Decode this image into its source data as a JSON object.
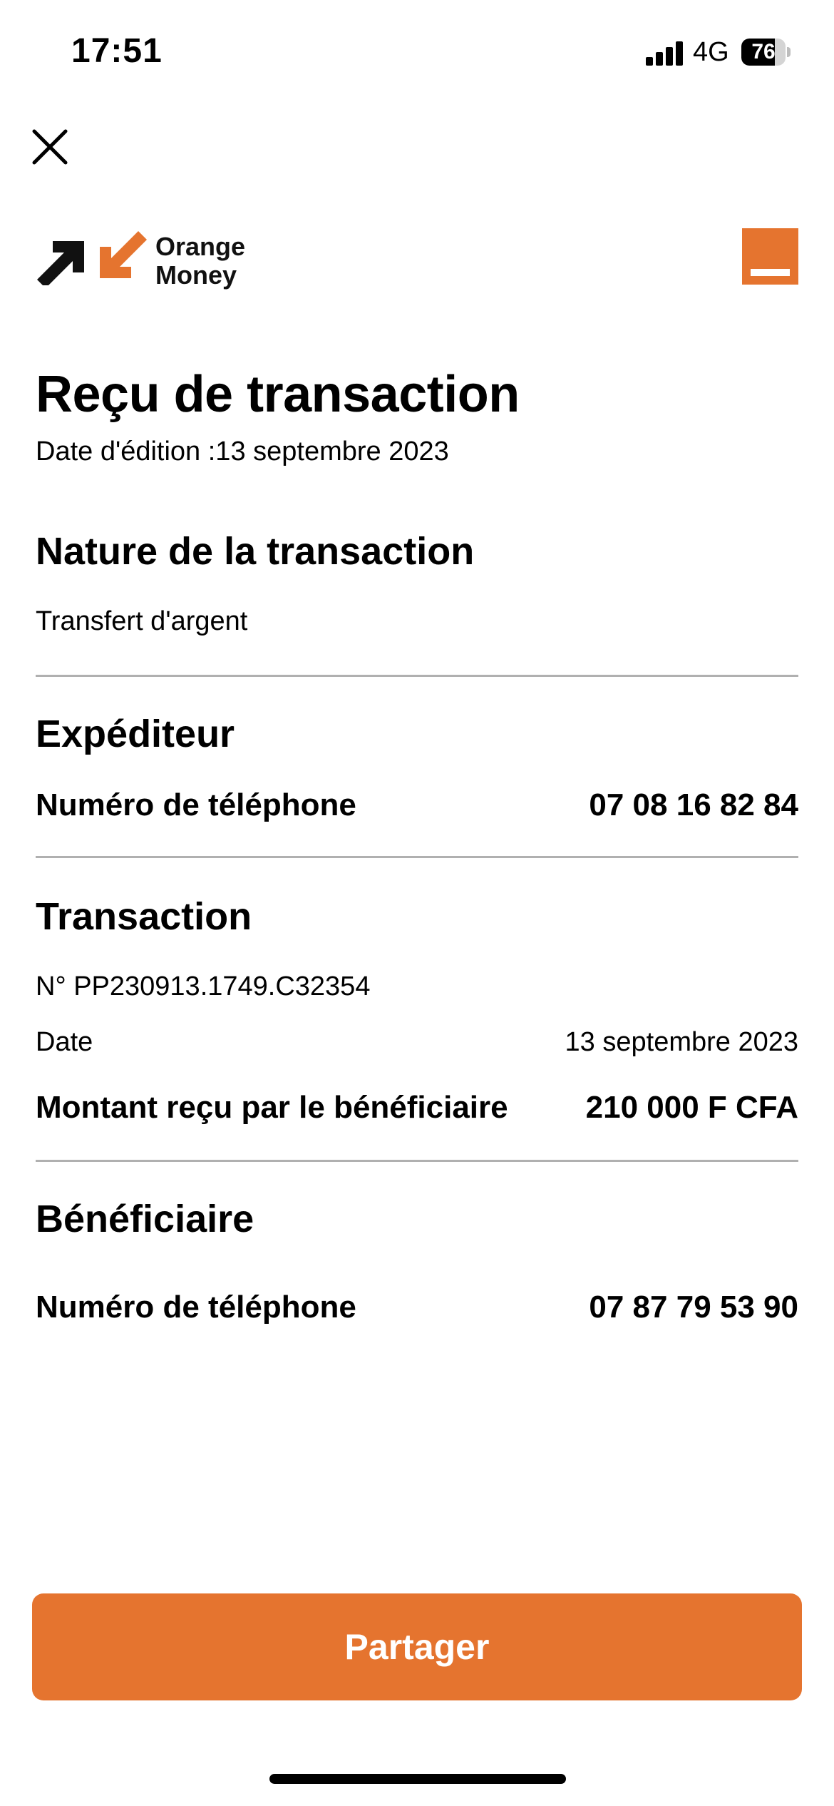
{
  "status_bar": {
    "time": "17:51",
    "network": "4G",
    "battery": "76",
    "battery_level": 0.76
  },
  "icons": {
    "close": "close-icon",
    "logo": "orange-money-arrows-logo",
    "brand_square": "orange-square-logo"
  },
  "brand": {
    "line1": "Orange",
    "line2": "Money"
  },
  "colors": {
    "accent": "#e5742f",
    "divider": "#b0b0b0"
  },
  "receipt": {
    "title": "Reçu de transaction",
    "edition_date": "Date d'édition :13 septembre 2023",
    "nature": {
      "heading": "Nature de la transaction",
      "value": "Transfert d'argent"
    },
    "sender": {
      "heading": "Expéditeur",
      "phone_label": "Numéro de téléphone",
      "phone_value": "07 08 16 82 84"
    },
    "transaction": {
      "heading": "Transaction",
      "number": "N° PP230913.1749.C32354",
      "date_label": "Date",
      "date_value": "13 septembre 2023",
      "amount_label": "Montant reçu par le bénéficiaire",
      "amount_value": "210 000 F CFA"
    },
    "beneficiary": {
      "heading": "Bénéficiaire",
      "phone_label": "Numéro de téléphone",
      "phone_value": "07 87 79 53 90"
    }
  },
  "share_button": {
    "label": "Partager"
  }
}
